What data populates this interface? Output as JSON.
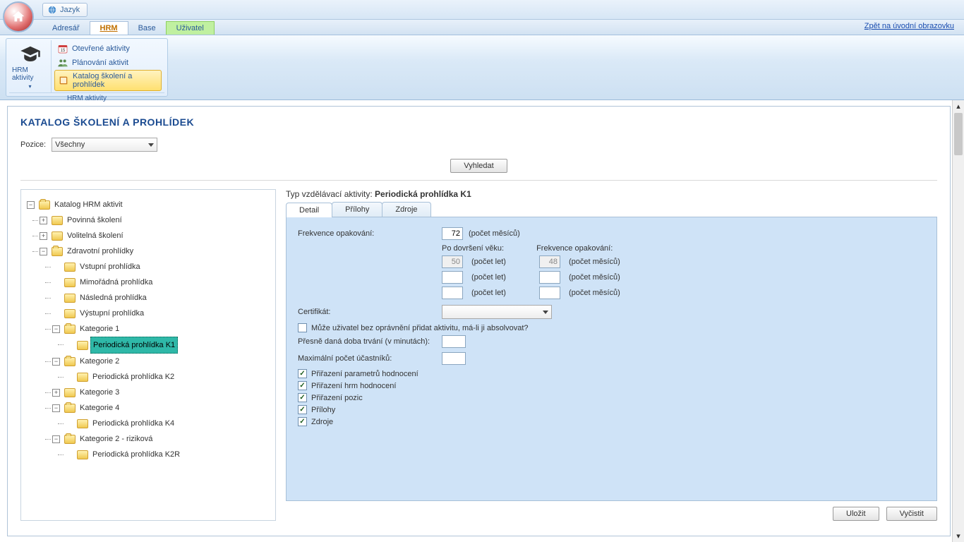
{
  "titlebar": {
    "jazyk": "Jazyk"
  },
  "modtabs": {
    "items": [
      "Adresář",
      "HRM",
      "Base",
      "Uživatel"
    ],
    "active_index": 1,
    "backlink": "Zpět na úvodní obrazovku"
  },
  "ribbon": {
    "big_label": "HRM aktivity",
    "items": [
      "Otevřené aktivity",
      "Plánování aktivit",
      "Katalog školení a prohlídek"
    ],
    "selected_index": 2,
    "group_title": "HRM aktivity"
  },
  "page": {
    "title": "KATALOG ŠKOLENÍ A PROHLÍDEK",
    "pozice_label": "Pozice:",
    "pozice_value": "Všechny",
    "search_btn": "Vyhledat"
  },
  "tree": {
    "root": "Katalog HRM aktivit",
    "n1": "Povinná školení",
    "n2": "Volitelná školení",
    "n3": "Zdravotní prohlídky",
    "n3a": "Vstupní prohlídka",
    "n3b": "Mimořádná prohlídka",
    "n3c": "Následná prohlídka",
    "n3d": "Výstupní prohlídka",
    "n3e": "Kategorie 1",
    "n3e1": "Periodická prohlídka K1",
    "n3f": "Kategorie 2",
    "n3f1": "Periodická prohlídka K2",
    "n3g": "Kategorie 3",
    "n3h": "Kategorie 4",
    "n3h1": "Periodická prohlídka K4",
    "n3i": "Kategorie 2 - riziková",
    "n3i1": "Periodická prohlídka K2R"
  },
  "detail": {
    "header_prefix": "Typ vzdělávací aktivity: ",
    "header_name": "Periodická prohlídka K1",
    "tabs": [
      "Detail",
      "Přílohy",
      "Zdroje"
    ],
    "active_tab": 0,
    "freq_label": "Frekvence opakování:",
    "freq_value": "72",
    "freq_unit": "(počet měsíců)",
    "age_col1": "Po dovršení věku:",
    "age_col2": "Frekvence opakování:",
    "age_unit1": "(počet let)",
    "age_unit2": "(počet měsíců)",
    "age_rows": [
      {
        "age": "50",
        "freq": "48"
      },
      {
        "age": "",
        "freq": ""
      },
      {
        "age": "",
        "freq": ""
      }
    ],
    "cert_label": "Certifikát:",
    "perm_label": "Může uživatel bez oprávnění přidat aktivitu, má-li ji absolvovat?",
    "duration_label": "Přesně daná doba trvání (v minutách):",
    "maxpart_label": "Maximální počet účastníků:",
    "chk1": "Přiřazení parametrů hodnocení",
    "chk2": "Přiřazení hrm hodnocení",
    "chk3": "Přiřazení pozic",
    "chk4": "Přílohy",
    "chk5": "Zdroje",
    "save_btn": "Uložit",
    "clear_btn": "Vyčistit"
  }
}
